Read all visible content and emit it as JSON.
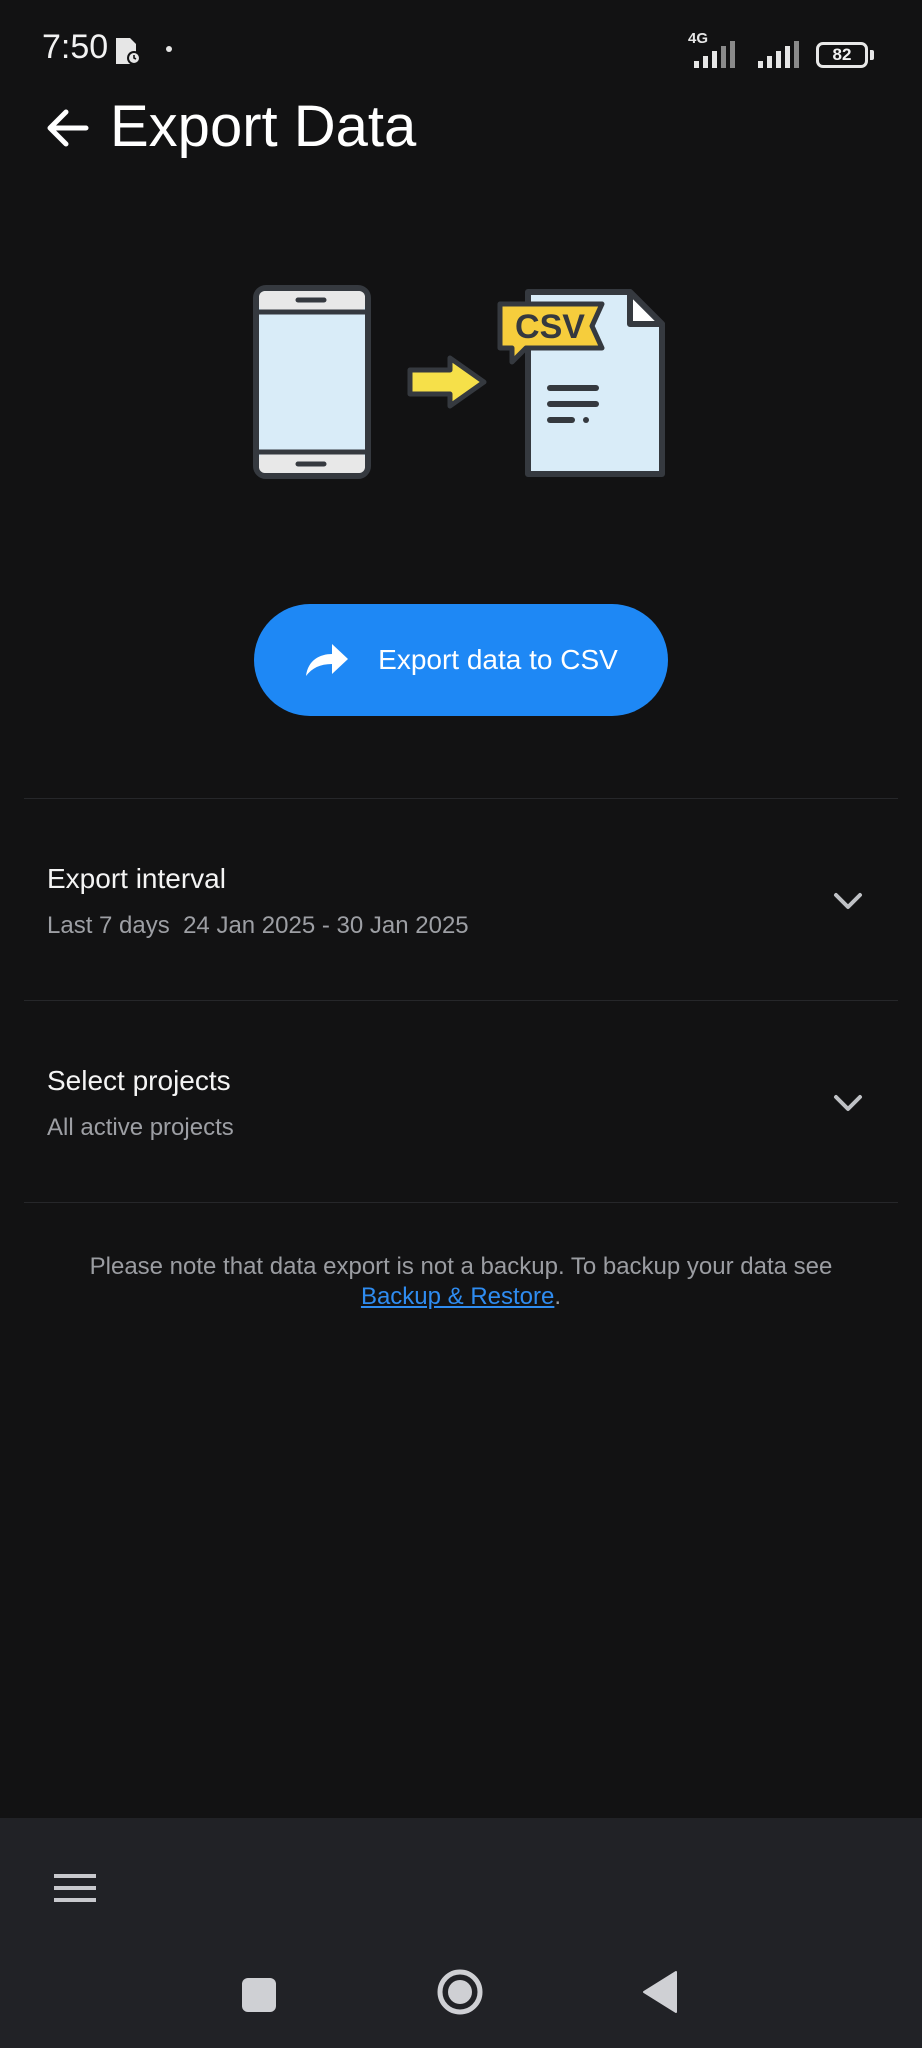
{
  "status_bar": {
    "time": "7:50",
    "network": "4G",
    "battery": "82"
  },
  "header": {
    "title": "Export Data"
  },
  "illustration": {
    "badge_text": "CSV"
  },
  "export_button": {
    "label": "Export data to CSV",
    "color": "#1e88f5"
  },
  "settings": {
    "export_interval": {
      "title": "Export interval",
      "value": "Last 7 days  24 Jan 2025 - 30 Jan 2025"
    },
    "select_projects": {
      "title": "Select projects",
      "value": "All active projects"
    }
  },
  "note": {
    "text": "Please note that data export is not a backup. To backup your data see",
    "link": "Backup & Restore",
    "suffix": "."
  },
  "colors": {
    "background": "#121213",
    "accent": "#1e88f5",
    "link": "#2f8cf0",
    "bottom_bar": "#212226"
  }
}
